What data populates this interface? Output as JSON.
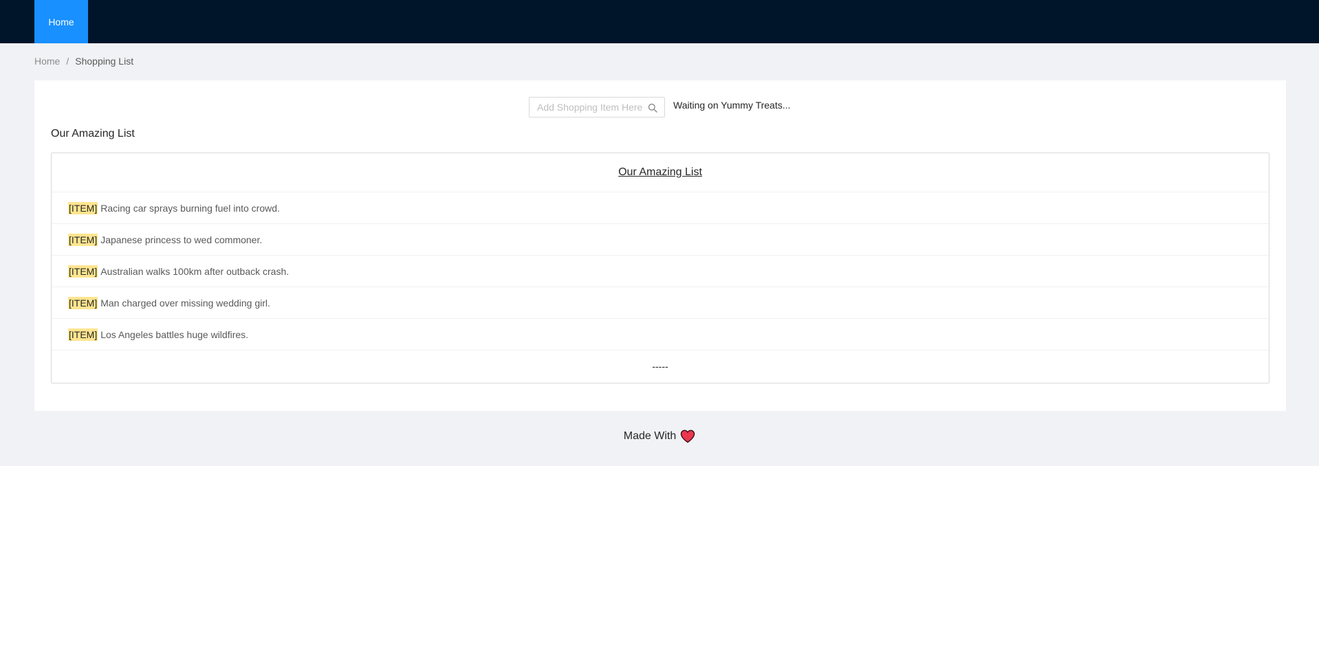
{
  "nav": {
    "home_label": "Home"
  },
  "breadcrumb": {
    "home": "Home",
    "separator": "/",
    "current": "Shopping List"
  },
  "search": {
    "placeholder": "Add Shopping Item Here",
    "value": ""
  },
  "status_text": "Waiting on Yummy Treats...",
  "section_title": "Our Amazing List",
  "list": {
    "header": "Our Amazing List",
    "items": [
      {
        "tag": "[ITEM]",
        "text": "Racing car sprays burning fuel into crowd."
      },
      {
        "tag": "[ITEM]",
        "text": "Japanese princess to wed commoner."
      },
      {
        "tag": "[ITEM]",
        "text": "Australian walks 100km after outback crash."
      },
      {
        "tag": "[ITEM]",
        "text": "Man charged over missing wedding girl."
      },
      {
        "tag": "[ITEM]",
        "text": "Los Angeles battles huge wildfires."
      }
    ],
    "footer": "-----"
  },
  "footer": {
    "text": "Made With",
    "icon": "heart-icon"
  },
  "colors": {
    "navbar": "#001529",
    "nav_active": "#1890ff",
    "page_bg": "#f0f2f5",
    "item_tag_highlight": "#ffe58f",
    "heart": "#e8384f"
  }
}
